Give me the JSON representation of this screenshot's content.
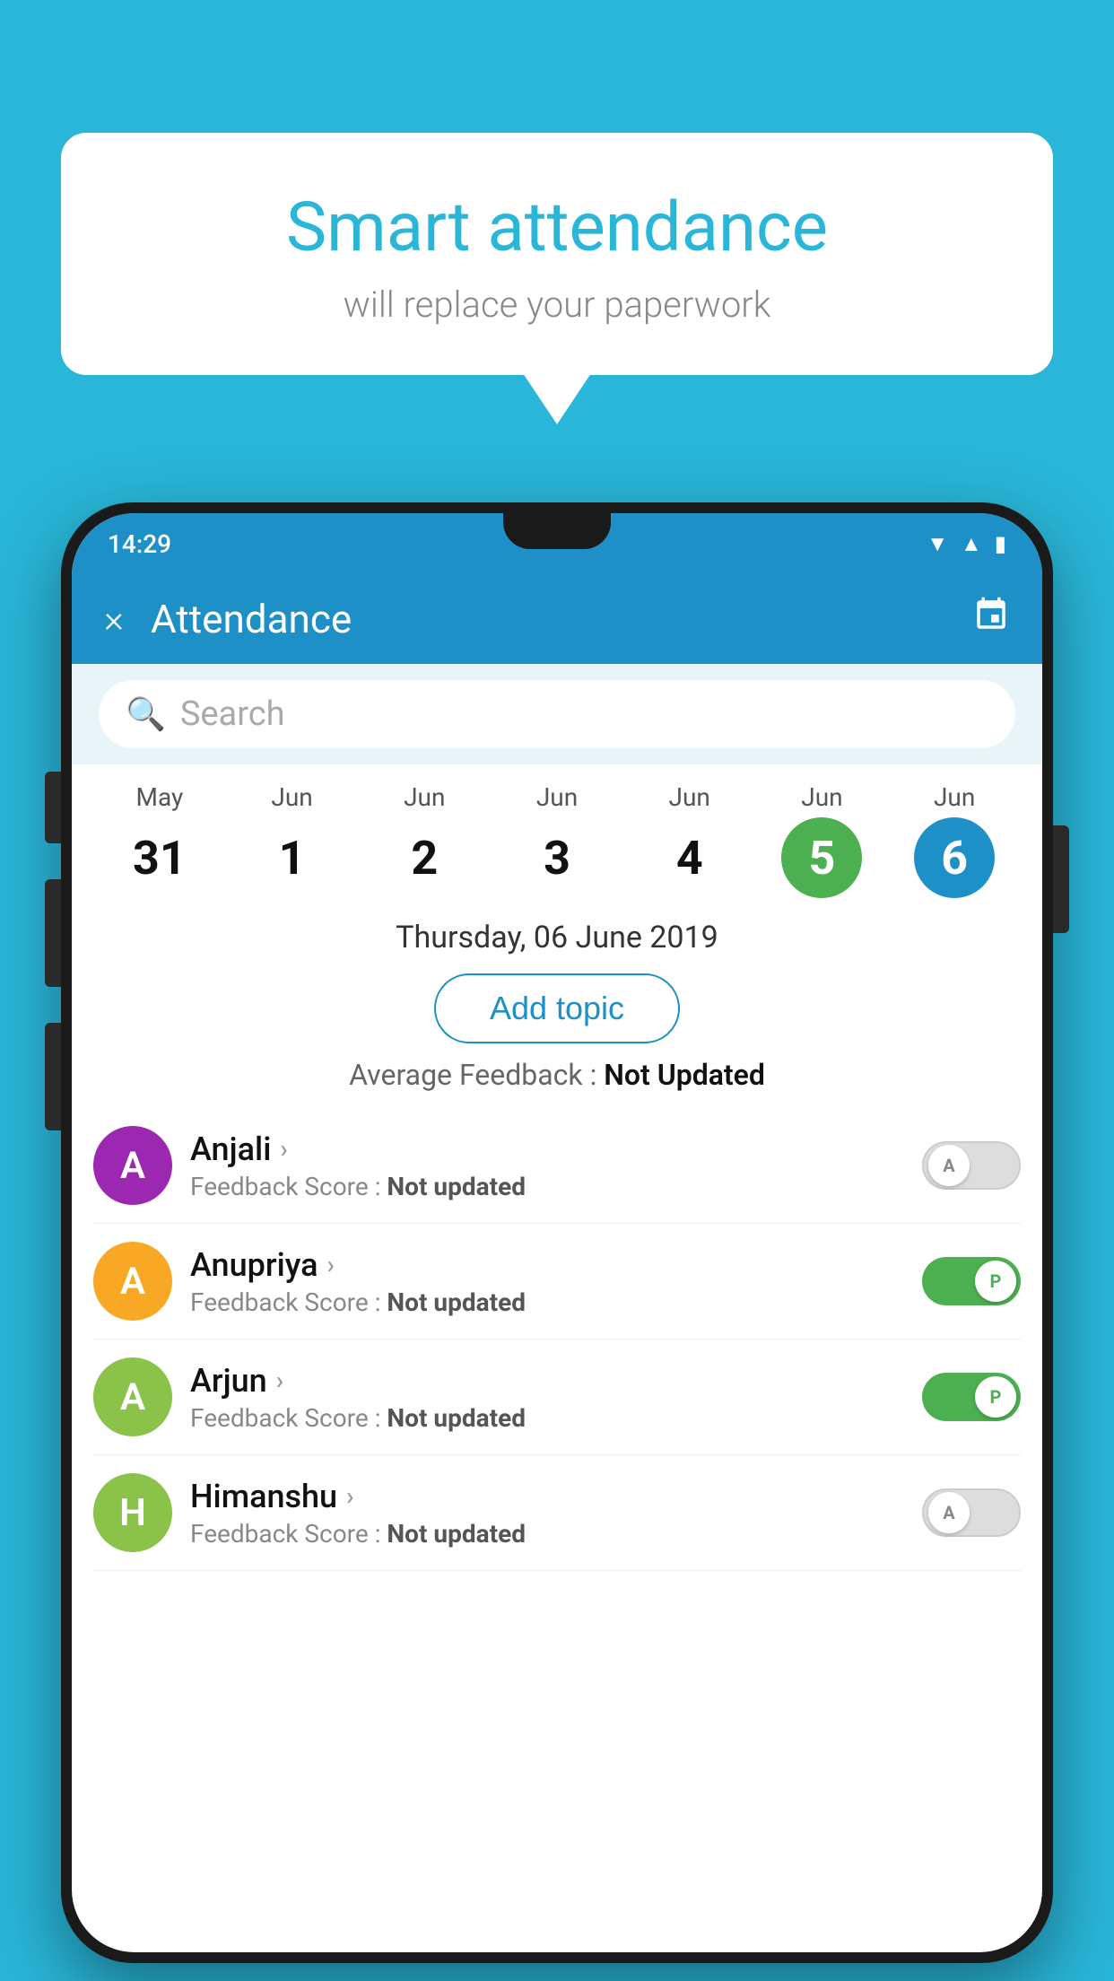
{
  "background_color": "#29b6d8",
  "speech_bubble": {
    "title": "Smart attendance",
    "subtitle": "will replace your paperwork"
  },
  "phone": {
    "status_bar": {
      "time": "14:29",
      "icons": [
        "wifi",
        "signal",
        "battery"
      ]
    },
    "app_bar": {
      "title": "Attendance",
      "close_label": "×",
      "calendar_icon": "📅"
    },
    "search": {
      "placeholder": "Search"
    },
    "date_strip": {
      "dates": [
        {
          "month": "May",
          "day": "31",
          "state": "normal"
        },
        {
          "month": "Jun",
          "day": "1",
          "state": "normal"
        },
        {
          "month": "Jun",
          "day": "2",
          "state": "normal"
        },
        {
          "month": "Jun",
          "day": "3",
          "state": "normal"
        },
        {
          "month": "Jun",
          "day": "4",
          "state": "normal"
        },
        {
          "month": "Jun",
          "day": "5",
          "state": "today"
        },
        {
          "month": "Jun",
          "day": "6",
          "state": "selected"
        }
      ]
    },
    "selected_date_label": "Thursday, 06 June 2019",
    "add_topic_label": "Add topic",
    "feedback_avg_label": "Average Feedback : ",
    "feedback_avg_value": "Not Updated",
    "students": [
      {
        "name": "Anjali",
        "avatar_letter": "A",
        "avatar_color": "#9c27b0",
        "feedback_label": "Feedback Score : ",
        "feedback_value": "Not updated",
        "toggle_state": "off",
        "toggle_label": "A"
      },
      {
        "name": "Anupriya",
        "avatar_letter": "A",
        "avatar_color": "#f9a825",
        "feedback_label": "Feedback Score : ",
        "feedback_value": "Not updated",
        "toggle_state": "on",
        "toggle_label": "P"
      },
      {
        "name": "Arjun",
        "avatar_letter": "A",
        "avatar_color": "#8bc34a",
        "feedback_label": "Feedback Score : ",
        "feedback_value": "Not updated",
        "toggle_state": "on",
        "toggle_label": "P"
      },
      {
        "name": "Himanshu",
        "avatar_letter": "H",
        "avatar_color": "#8bc34a",
        "feedback_label": "Feedback Score : ",
        "feedback_value": "Not updated",
        "toggle_state": "off",
        "toggle_label": "A"
      }
    ]
  }
}
